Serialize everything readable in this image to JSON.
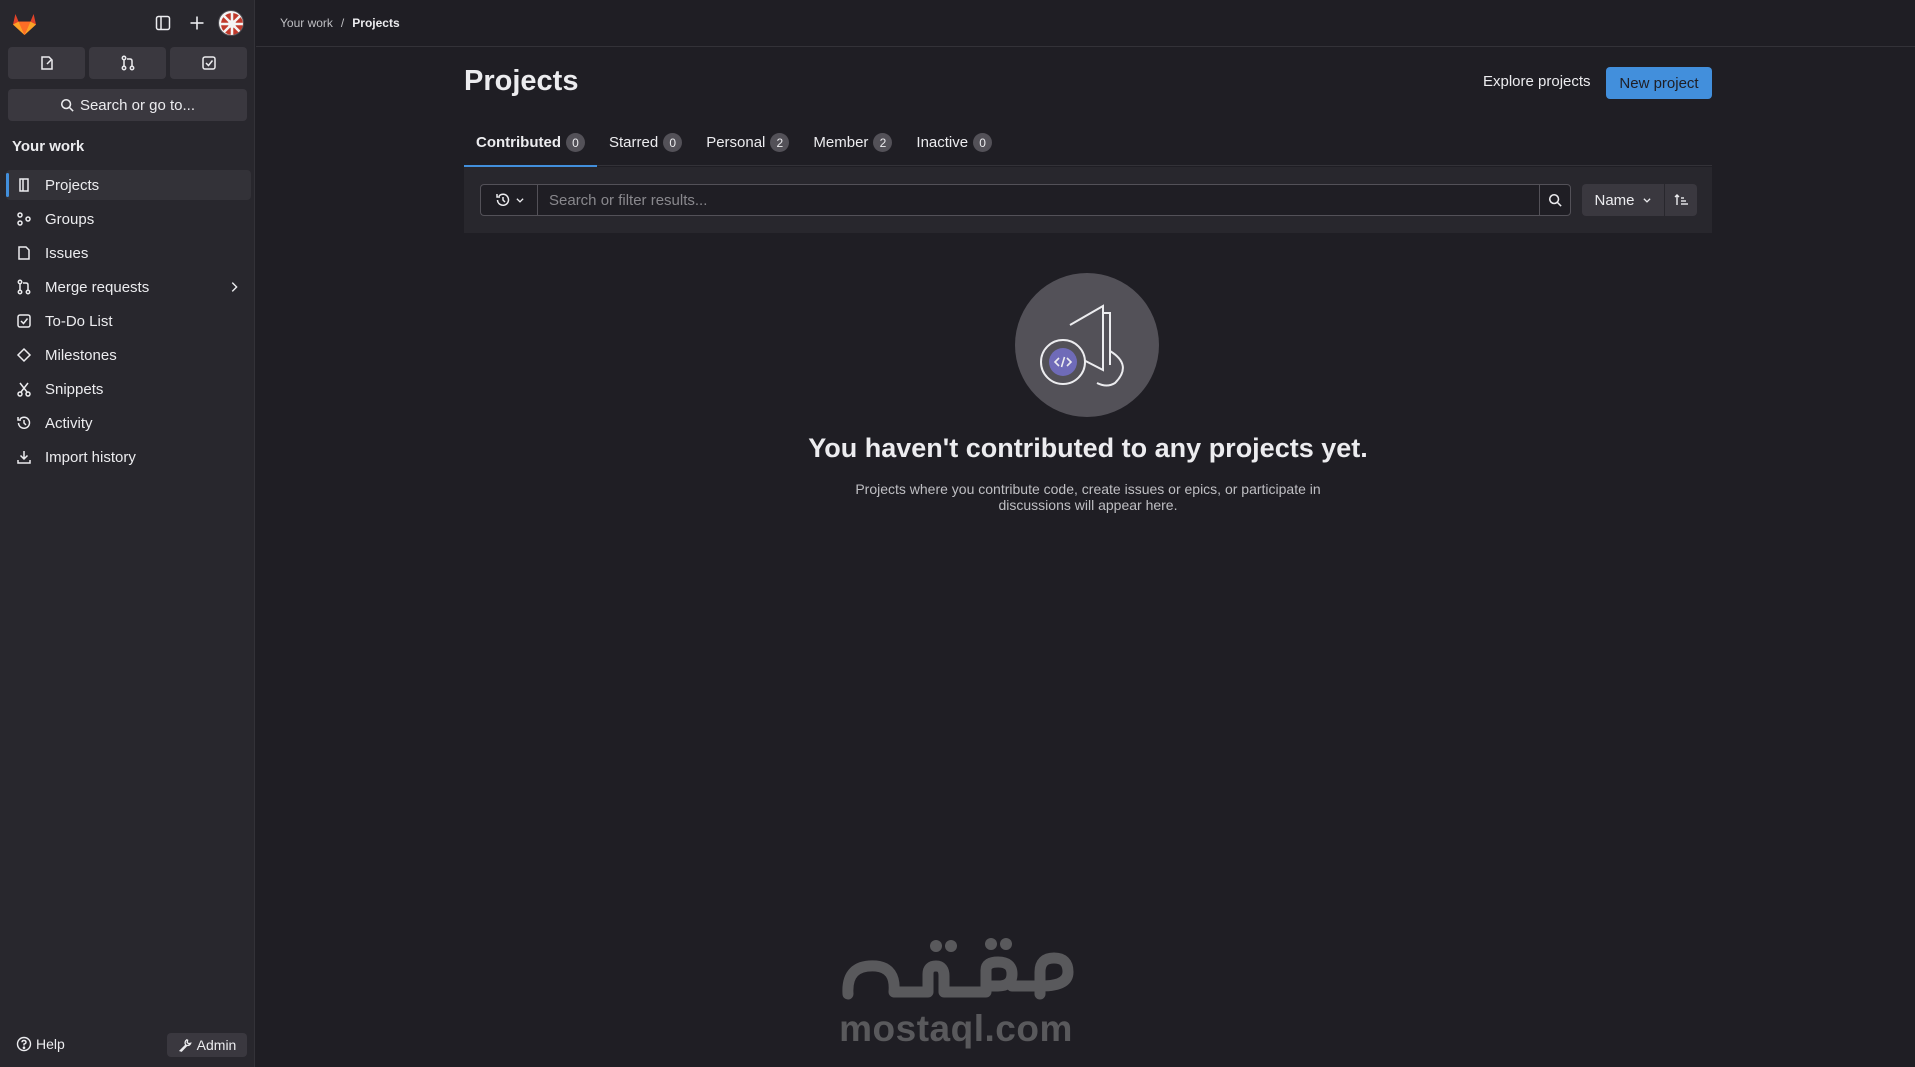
{
  "sidebar": {
    "section_title": "Your work",
    "search_label": "Search or go to...",
    "items": [
      {
        "label": "Projects",
        "icon": "project-icon"
      },
      {
        "label": "Groups",
        "icon": "group-icon"
      },
      {
        "label": "Issues",
        "icon": "issues-icon"
      },
      {
        "label": "Merge requests",
        "icon": "merge-request-icon"
      },
      {
        "label": "To-Do List",
        "icon": "todo-icon"
      },
      {
        "label": "Milestones",
        "icon": "milestone-icon"
      },
      {
        "label": "Snippets",
        "icon": "snippet-icon"
      },
      {
        "label": "Activity",
        "icon": "history-icon"
      },
      {
        "label": "Import history",
        "icon": "download-icon"
      }
    ],
    "help_label": "Help",
    "admin_label": "Admin"
  },
  "breadcrumb": {
    "parent": "Your work",
    "separator": "/",
    "current": "Projects"
  },
  "page": {
    "title": "Projects",
    "explore_label": "Explore projects",
    "new_project_label": "New project"
  },
  "tabs": [
    {
      "label": "Contributed",
      "count": "0"
    },
    {
      "label": "Starred",
      "count": "0"
    },
    {
      "label": "Personal",
      "count": "2"
    },
    {
      "label": "Member",
      "count": "2"
    },
    {
      "label": "Inactive",
      "count": "0"
    }
  ],
  "filter": {
    "placeholder": "Search or filter results...",
    "value": "",
    "sort_label": "Name"
  },
  "empty_state": {
    "title": "You haven't contributed to any projects yet.",
    "description": "Projects where you contribute code, create issues or epics, or participate in discussions will appear here."
  },
  "watermark": {
    "arabic": "مستقل",
    "domain": "mostaql.com"
  },
  "colors": {
    "accent": "#428fdc",
    "background": "#1f1e24",
    "sidebar": "#28272d",
    "logo": "#fc6d26"
  }
}
